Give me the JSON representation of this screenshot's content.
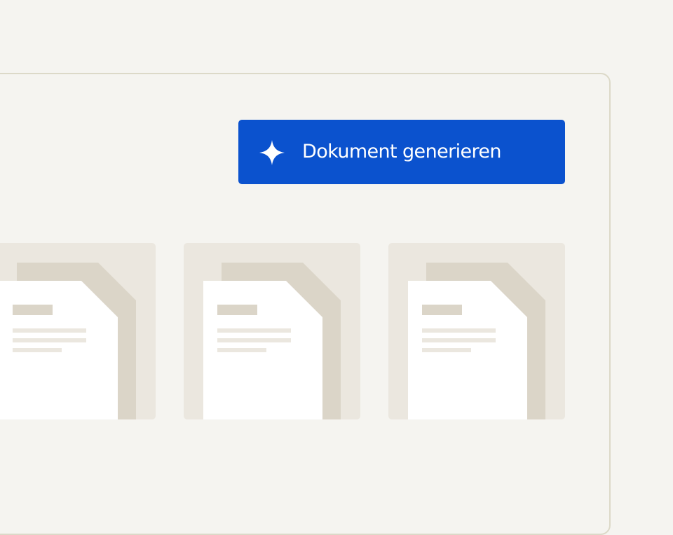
{
  "toolbar": {
    "generate_label": "Dokument generieren",
    "generate_icon": "sparkle-icon"
  },
  "documents": [
    {
      "icon": "document-icon"
    },
    {
      "icon": "document-icon"
    },
    {
      "icon": "document-icon"
    }
  ],
  "colors": {
    "background": "#f5f4f0",
    "panel_border": "#dcd9c8",
    "accent": "#0b52ce",
    "card": "#ebe7df",
    "document_back": "#dbd5c8",
    "document_front": "#ffffff",
    "document_lines": "#ebe7df",
    "document_heading": "#dbd5c8"
  }
}
